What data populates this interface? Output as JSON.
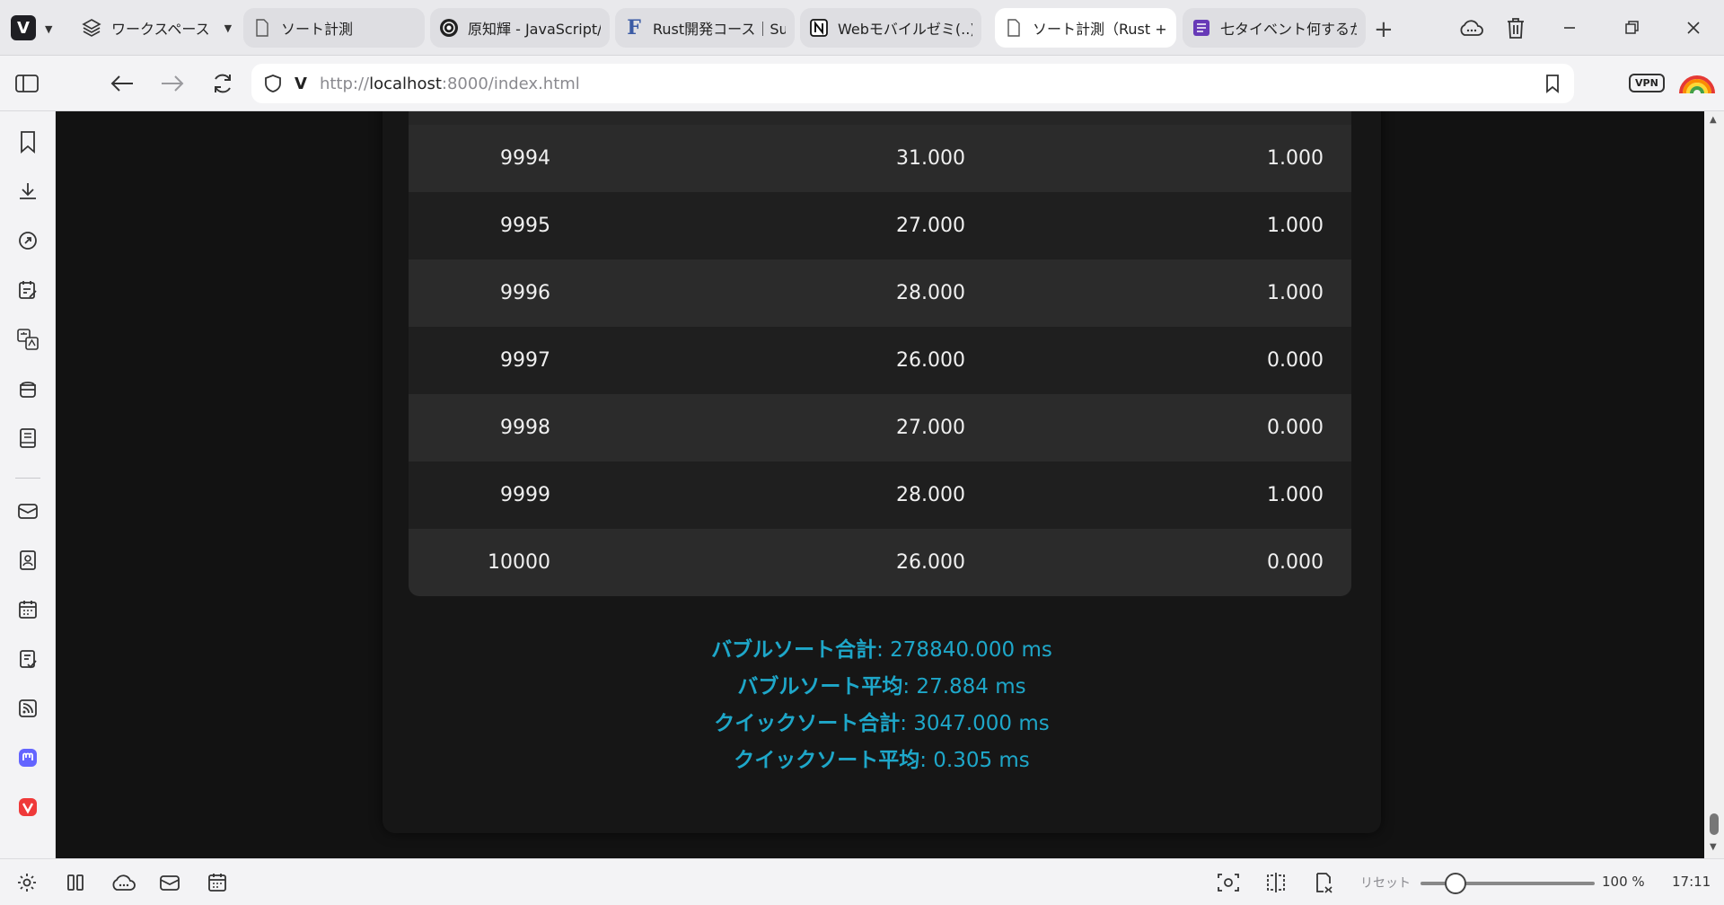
{
  "browser": {
    "workspace_label": "ワークスペース",
    "tabs": [
      {
        "label": "ソート計測",
        "icon": "page-icon",
        "active": false
      },
      {
        "label": "原知輝 - JavaScript/",
        "icon": "swirl-site-icon",
        "active": false
      },
      {
        "label": "Rust開発コース｜Sun",
        "icon": "f-site-icon",
        "active": false
      },
      {
        "label": "Webモバイルゼミ(..)φ",
        "icon": "notion-icon",
        "active": false
      },
      {
        "label": "ソート計測（Rust + V",
        "icon": "page-icon",
        "active": true
      },
      {
        "label": "七タイベント何するか",
        "icon": "forms-icon",
        "active": false
      }
    ],
    "url": {
      "prefix": "http://",
      "host": "localhost",
      "rest": ":8000/index.html"
    },
    "vpn_label": "VPN"
  },
  "table": {
    "rows": [
      {
        "n": "9994",
        "bubble": "31.000",
        "quick": "1.000"
      },
      {
        "n": "9995",
        "bubble": "27.000",
        "quick": "1.000"
      },
      {
        "n": "9996",
        "bubble": "28.000",
        "quick": "1.000"
      },
      {
        "n": "9997",
        "bubble": "26.000",
        "quick": "0.000"
      },
      {
        "n": "9998",
        "bubble": "27.000",
        "quick": "0.000"
      },
      {
        "n": "9999",
        "bubble": "28.000",
        "quick": "1.000"
      },
      {
        "n": "10000",
        "bubble": "26.000",
        "quick": "0.000"
      }
    ]
  },
  "summary": {
    "bubble_total_label": "バブルソート合計",
    "bubble_total_value": ": 278840.000 ms",
    "bubble_avg_label": "バブルソート平均",
    "bubble_avg_value": ": 27.884 ms",
    "quick_total_label": "クイックソート合計",
    "quick_total_value": ": 3047.000 ms",
    "quick_avg_label": "クイックソート平均",
    "quick_avg_value": ": 0.305 ms"
  },
  "statusbar": {
    "reset_label": "リセット",
    "zoom": "100 %",
    "zoom_fraction": 0.2,
    "clock": "17:11"
  },
  "colors": {
    "accent": "#1ea7c9",
    "content_bg": "#121212"
  }
}
